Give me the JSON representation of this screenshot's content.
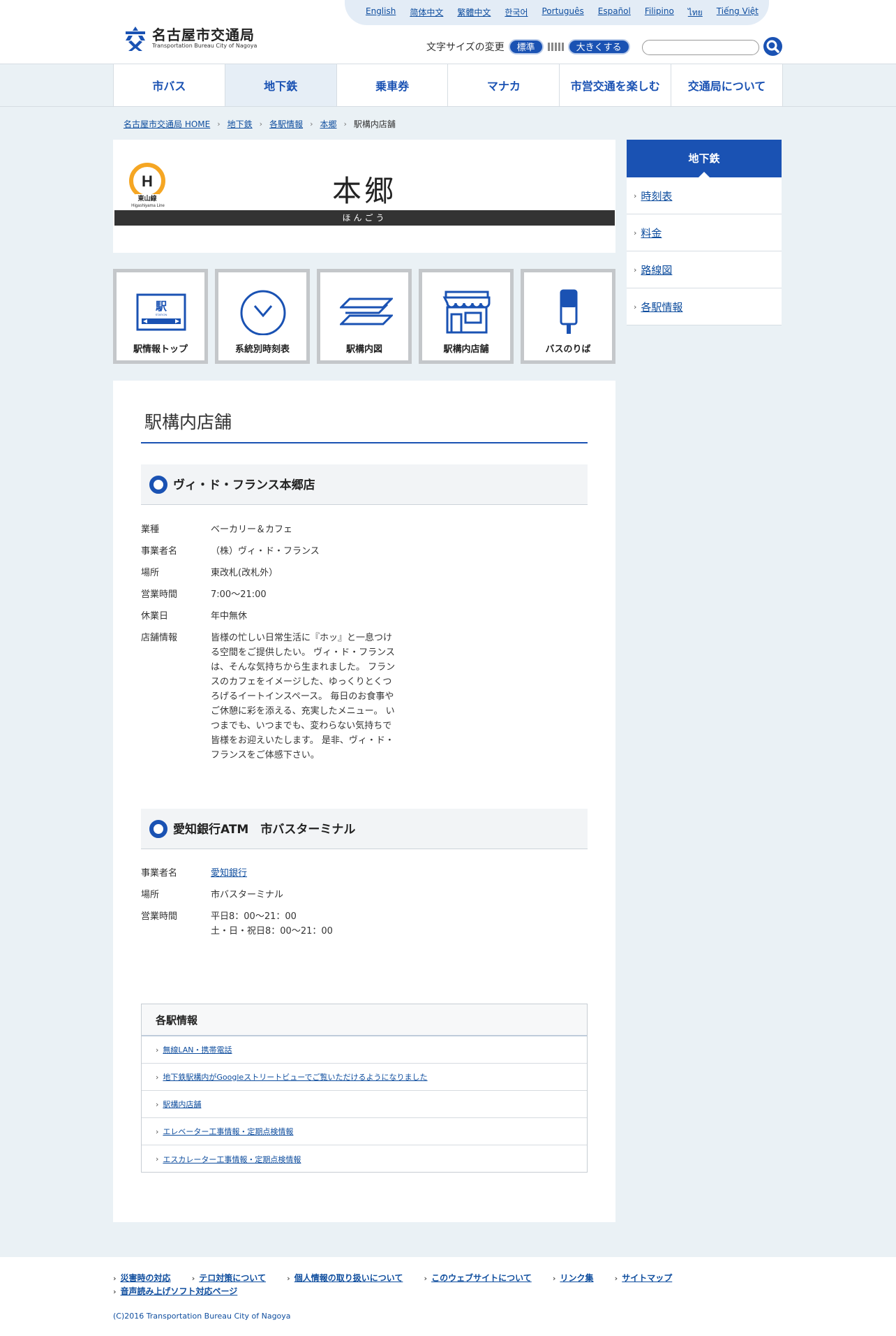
{
  "header": {
    "logo_ja": "名古屋市交通局",
    "logo_en": "Transportation Bureau City of Nagoya",
    "languages": [
      "English",
      "简体中文",
      "繁體中文",
      "한국어",
      "Português",
      "Español",
      "Filipino",
      "ไทย",
      "Tiếng Việt"
    ],
    "font_size_label": "文字サイズの変更",
    "font_standard": "標準",
    "font_large": "大きくする",
    "search_placeholder": ""
  },
  "nav": [
    "市バス",
    "地下鉄",
    "乗車券",
    "マナカ",
    "市営交通を楽しむ",
    "交通局について"
  ],
  "breadcrumb": [
    "名古屋市交通局 HOME",
    "地下鉄",
    "各駅情報",
    "本郷",
    "駅構内店舗"
  ],
  "station": {
    "line_letter": "H",
    "line_name_ja": "東山線",
    "line_name_en": "Higashiyama Line",
    "name": "本郷",
    "kana": "ほんごう"
  },
  "icon_buttons": [
    "駅情報トップ",
    "系統別時刻表",
    "駅構内図",
    "駅構内店舗",
    "バスのりば"
  ],
  "main": {
    "title": "駅構内店舗",
    "shops": [
      {
        "name": "ヴィ・ド・フランス本郷店",
        "rows": [
          {
            "k": "業種",
            "v": "ベーカリー＆カフェ"
          },
          {
            "k": "事業者名",
            "v": "（株）ヴィ・ド・フランス"
          },
          {
            "k": "場所",
            "v": "東改札(改札外）"
          },
          {
            "k": "営業時間",
            "v": "7:00～21:00"
          },
          {
            "k": "休業日",
            "v": "年中無休"
          },
          {
            "k": "店舗情報",
            "v": "皆様の忙しい日常生活に『ホッ』と一息つける空間をご提供したい。 ヴィ・ド・フランスは、そんな気持ちから生まれました。 フランスのカフェをイメージした、ゆっくりとくつろげるイートインスペース。 毎日のお食事やご休憩に彩を添える、充実したメニュー。 いつまでも、いつまでも、変わらない気持ちで皆様をお迎えいたします。 是非、ヴィ・ド・フランスをご体感下さい。"
          }
        ]
      },
      {
        "name": "愛知銀行ATM　市バスターミナル",
        "rows": [
          {
            "k": "事業者名",
            "v": "愛知銀行"
          },
          {
            "k": "場所",
            "v": "市バスターミナル"
          },
          {
            "k": "営業時間",
            "v": "平日8：00～21：00"
          },
          {
            "k": "",
            "v": "土・日・祝日8：00～21：00"
          }
        ]
      }
    ],
    "sub_box": {
      "title": "各駅情報",
      "links": [
        "無線LAN・携帯電話",
        "地下鉄駅構内がGoogleストリートビューでご覧いただけるようになりました",
        "駅構内店舗",
        "エレベーター工事情報・定期点検情報",
        "エスカレーター工事情報・定期点検情報"
      ]
    }
  },
  "side": {
    "title": "地下鉄",
    "items": [
      "時刻表",
      "料金",
      "路線図",
      "各駅情報"
    ]
  },
  "footer": {
    "links": [
      "災害時の対応",
      "テロ対策について",
      "個人情報の取り扱いについて",
      "このウェブサイトについて",
      "リンク集",
      "サイトマップ",
      "音声読み上げソフト対応ページ"
    ],
    "copyright": "(C)2016 Transportation Bureau City of Nagoya"
  },
  "colors": {
    "brand_blue": "#1a52b3",
    "line_yellow": "#f5a623",
    "background": "#eaf1f5"
  }
}
